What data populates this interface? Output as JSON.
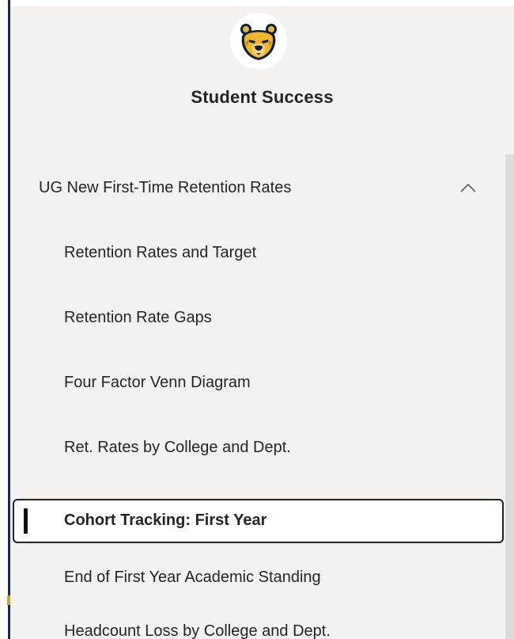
{
  "app": {
    "title": "Student Success",
    "logo_icon": "bear-mascot-icon"
  },
  "nav": {
    "section": {
      "label": "UG New First-Time Retention Rates",
      "expanded": true,
      "toggle_icon": "chevron-up-icon"
    },
    "items": [
      {
        "label": "Retention Rates and Target",
        "selected": false
      },
      {
        "label": "Retention Rate Gaps",
        "selected": false
      },
      {
        "label": "Four Factor Venn Diagram",
        "selected": false
      },
      {
        "label": "Ret. Rates by College and Dept.",
        "selected": false
      },
      {
        "label": "Cohort Tracking: First Year",
        "selected": true
      },
      {
        "label": "End of First Year Academic Standing",
        "selected": false
      },
      {
        "label": "Headcount Loss by College and Dept.",
        "selected": false
      }
    ]
  },
  "colors": {
    "pane_background": "#f3f2f1",
    "text": "#252423",
    "selected_background": "#ffffff",
    "selected_border": "#252423",
    "accent_navy": "#1c2b44",
    "accent_gold": "#c5a53a"
  }
}
